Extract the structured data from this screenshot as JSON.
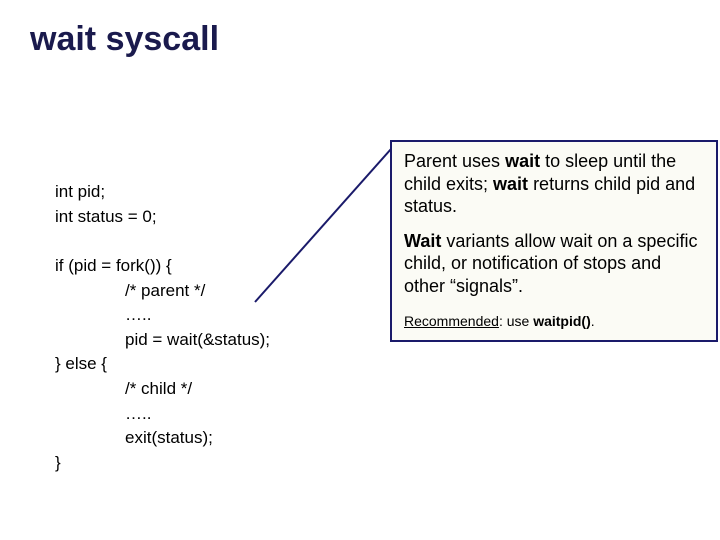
{
  "title": "wait syscall",
  "code": {
    "l1": "int pid;",
    "l2": "int status = 0;",
    "l3": "if (pid = fork()) {",
    "l4": "/* parent */",
    "l5": "…..",
    "l6": "pid = wait(&status);",
    "l7": "} else {",
    "l8": "/* child */",
    "l9": "…..",
    "l10": "exit(status);",
    "l11": "}"
  },
  "callout": {
    "p1a": "Parent uses ",
    "p1b": "wait",
    "p1c": " to sleep until the child exits; ",
    "p1d": "wait",
    "p1e": " returns child pid and status.",
    "p2a": "Wait",
    "p2b": " variants allow wait on a specific child, or notification of stops and other “signals”.",
    "p3a": "Recommended",
    "p3b": ": use ",
    "p3c": "waitpid()",
    "p3d": "."
  }
}
